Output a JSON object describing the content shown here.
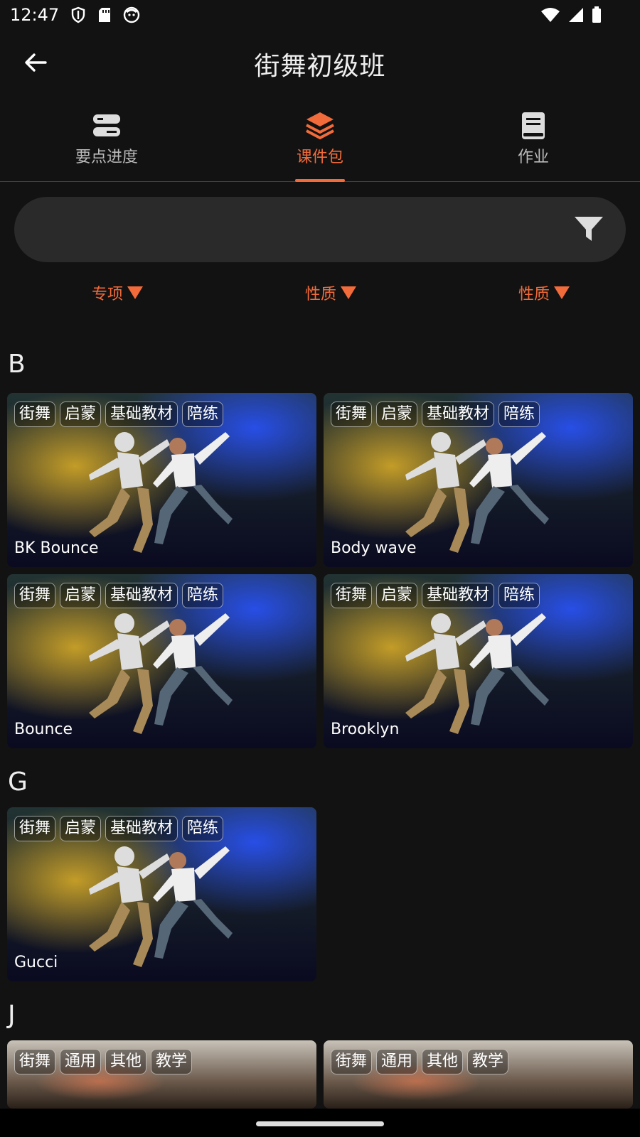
{
  "status": {
    "time": "12:47"
  },
  "appbar": {
    "title": "街舞初级班"
  },
  "tabs": [
    {
      "label": "要点进度",
      "icon": "progress-icon"
    },
    {
      "label": "课件包",
      "icon": "layers-icon",
      "active": true
    },
    {
      "label": "作业",
      "icon": "book-icon"
    }
  ],
  "search": {
    "value": "",
    "placeholder": ""
  },
  "filters": [
    {
      "label": "专项"
    },
    {
      "label": "性质"
    },
    {
      "label": "性质"
    }
  ],
  "sections": [
    {
      "letter": "B",
      "cards": [
        {
          "title": "BK Bounce",
          "tags": [
            "街舞",
            "启蒙",
            "基础教材",
            "陪练"
          ]
        },
        {
          "title": "Body wave",
          "tags": [
            "街舞",
            "启蒙",
            "基础教材",
            "陪练"
          ]
        },
        {
          "title": "Bounce",
          "tags": [
            "街舞",
            "启蒙",
            "基础教材",
            "陪练"
          ]
        },
        {
          "title": "Brooklyn",
          "tags": [
            "街舞",
            "启蒙",
            "基础教材",
            "陪练"
          ]
        }
      ]
    },
    {
      "letter": "G",
      "cards": [
        {
          "title": "Gucci",
          "tags": [
            "街舞",
            "启蒙",
            "基础教材",
            "陪练"
          ]
        }
      ]
    },
    {
      "letter": "J",
      "cards": [
        {
          "title": "",
          "tags": [
            "街舞",
            "通用",
            "其他",
            "教学"
          ]
        },
        {
          "title": "",
          "tags": [
            "街舞",
            "通用",
            "其他",
            "教学"
          ]
        }
      ]
    }
  ],
  "colors": {
    "accent": "#f26b3a",
    "background": "#121212",
    "search_bg": "#2a2a2a"
  }
}
